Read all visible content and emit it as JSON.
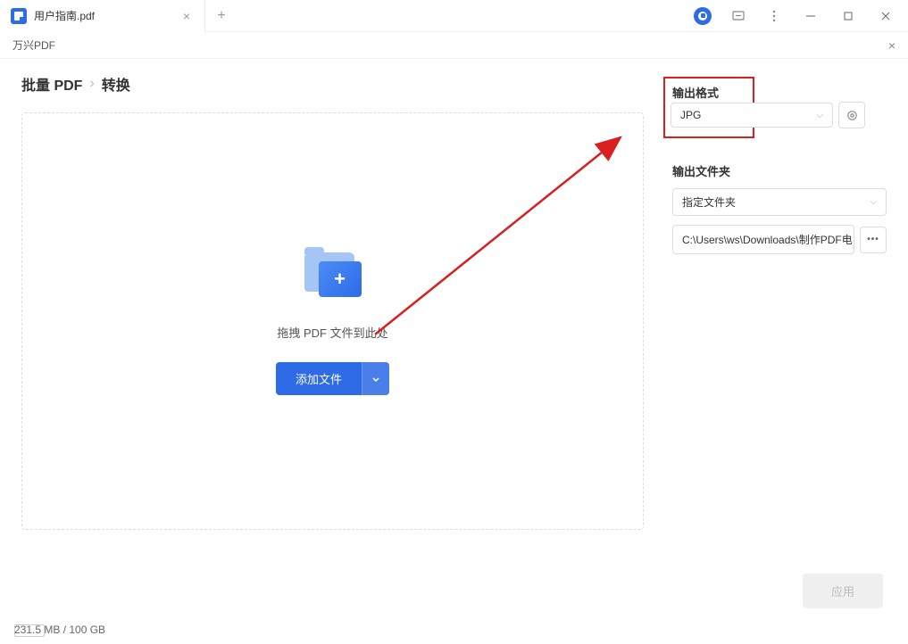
{
  "tab": {
    "title": "用户指南.pdf"
  },
  "dialog": {
    "title": "万兴PDF"
  },
  "breadcrumb": {
    "root": "批量 PDF",
    "current": "转换"
  },
  "dropzone": {
    "text": "拖拽 PDF 文件到此处",
    "add_button": "添加文件"
  },
  "output_format": {
    "label": "输出格式",
    "value": "JPG"
  },
  "output_folder": {
    "label": "输出文件夹",
    "mode": "指定文件夹",
    "path": "C:\\Users\\ws\\Downloads\\制作PDF电"
  },
  "footer": {
    "apply": "应用"
  },
  "status": {
    "storage": "231.5 MB / 100 GB"
  }
}
